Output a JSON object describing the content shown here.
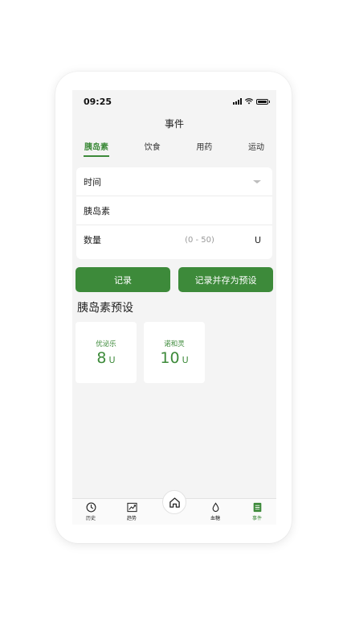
{
  "status": {
    "time": "09:25"
  },
  "nav": {
    "title": "事件"
  },
  "tabs": [
    {
      "label": "胰岛素",
      "active": true
    },
    {
      "label": "饮食",
      "active": false
    },
    {
      "label": "用药",
      "active": false
    },
    {
      "label": "运动",
      "active": false
    }
  ],
  "form": {
    "time_label": "时间",
    "insulin_label": "胰岛素",
    "quantity_label": "数量",
    "quantity_range": "(0 - 50)",
    "quantity_unit": "U"
  },
  "buttons": {
    "record": "记录",
    "record_save_preset": "记录并存为预设"
  },
  "presets": {
    "title": "胰岛素预设",
    "items": [
      {
        "name": "优泌乐",
        "value": "8",
        "unit": "U"
      },
      {
        "name": "诺和灵",
        "value": "10",
        "unit": "U"
      }
    ]
  },
  "bottom_nav": {
    "items": [
      {
        "label": "历史",
        "icon": "clock-icon"
      },
      {
        "label": "趋势",
        "icon": "trend-chart-icon"
      },
      {
        "label": "",
        "icon": "home-icon"
      },
      {
        "label": "血糖",
        "icon": "drop-icon"
      },
      {
        "label": "事件",
        "icon": "event-list-icon",
        "active": true
      }
    ]
  },
  "colors": {
    "accent": "#3d8a3a",
    "background": "#f4f4f4",
    "card": "#ffffff"
  }
}
